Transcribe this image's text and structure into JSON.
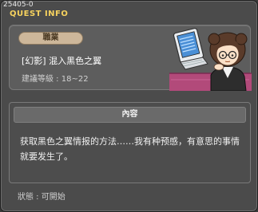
{
  "window": {
    "quest_id": "25405-0",
    "title": "QUEST INFO"
  },
  "info": {
    "job_label": "職業",
    "quest_name": "[幻影] 混入黑色之翼",
    "level_requirement": "建議等級 : 18~22",
    "npc": "npc-portrait-with-computer"
  },
  "content": {
    "header": "內容",
    "text": "获取黑色之翼情报的方法……我有种预感，有意思的事情就要发生了。"
  },
  "status": {
    "text": "狀態 : 可開始"
  },
  "colors": {
    "title": "#f6d25e",
    "badge": "#cdb79a",
    "background": "#4b4b4b"
  }
}
